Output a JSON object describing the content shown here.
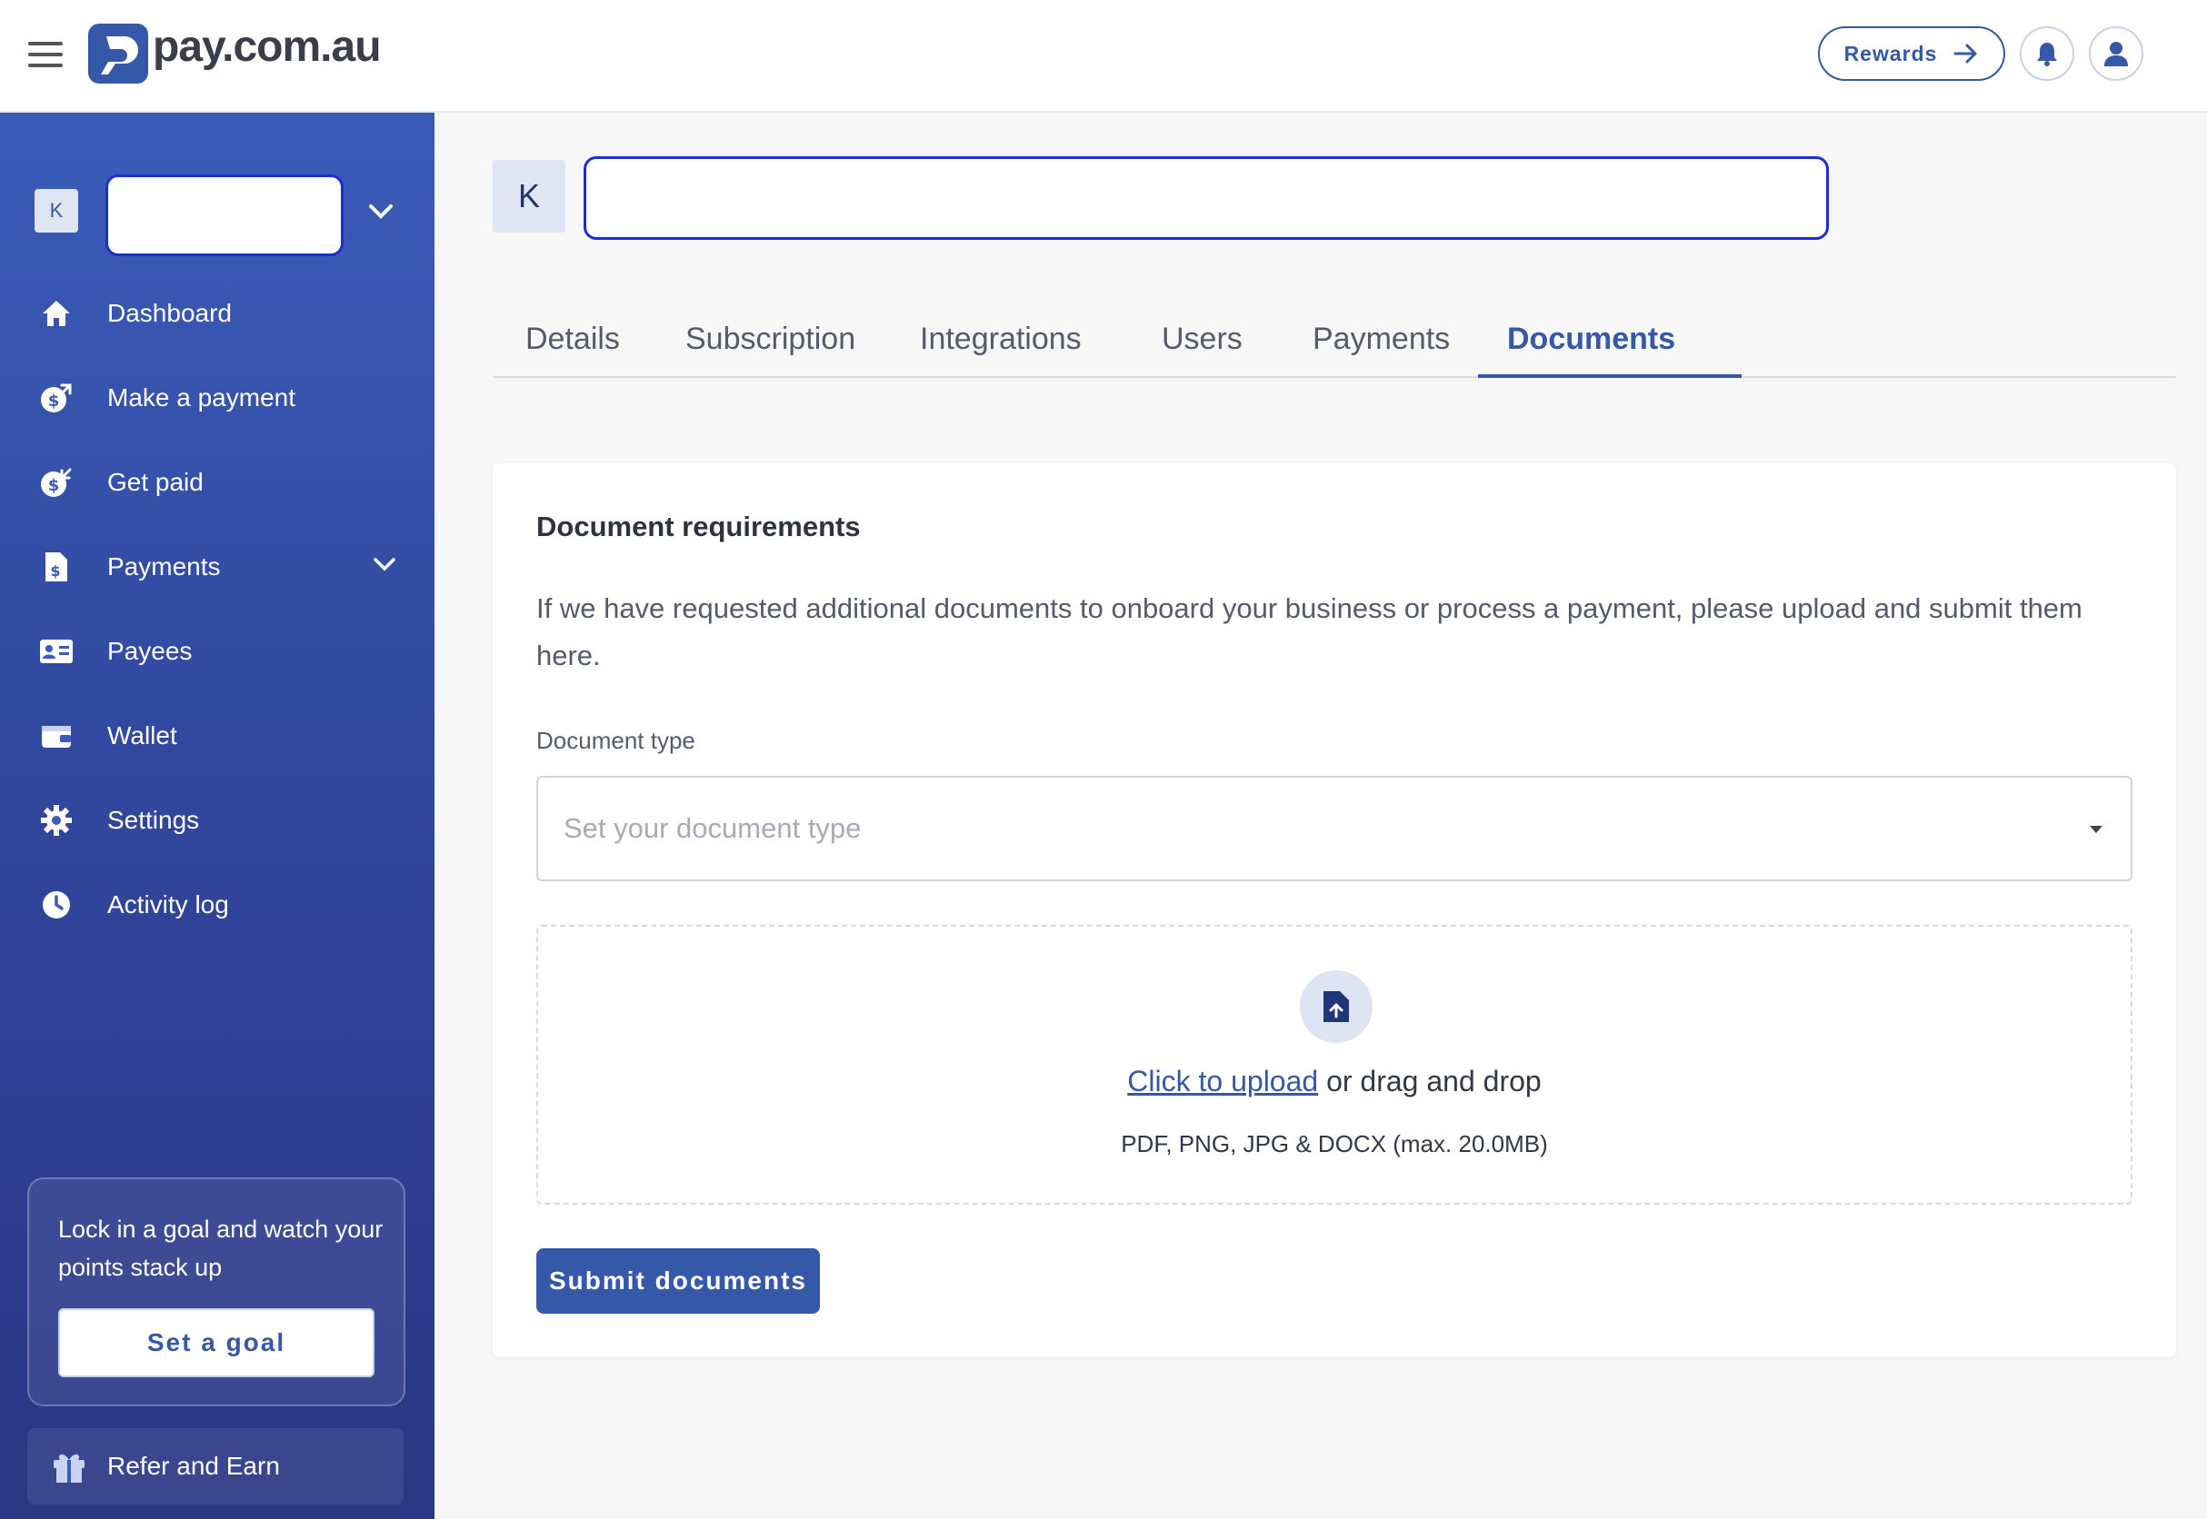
{
  "header": {
    "logo_text": "pay.com.au",
    "rewards_label": "Rewards"
  },
  "sidebar": {
    "account_initial": "K",
    "nav": [
      {
        "label": "Dashboard",
        "icon": "home-icon"
      },
      {
        "label": "Make a payment",
        "icon": "send-money-icon"
      },
      {
        "label": "Get paid",
        "icon": "receive-money-icon"
      },
      {
        "label": "Payments",
        "icon": "invoice-icon"
      },
      {
        "label": "Payees",
        "icon": "contact-card-icon"
      },
      {
        "label": "Wallet",
        "icon": "wallet-icon"
      },
      {
        "label": "Settings",
        "icon": "gear-icon"
      },
      {
        "label": "Activity log",
        "icon": "clock-icon"
      }
    ],
    "goal_text": "Lock in a goal and watch your points stack up",
    "goal_button": "Set a goal",
    "refer_label": "Refer and Earn"
  },
  "main": {
    "account_initial": "K",
    "tabs": [
      "Details",
      "Subscription",
      "Integrations",
      "Users",
      "Payments",
      "Documents"
    ],
    "active_tab": "Documents",
    "card": {
      "title": "Document requirements",
      "description": "If we have requested additional documents to onboard your business or process a payment, please upload and submit them here.",
      "doc_type_label": "Document type",
      "doc_type_placeholder": "Set your document type",
      "upload_link": "Click to upload",
      "upload_rest": " or drag and drop",
      "upload_hint": "PDF, PNG, JPG & DOCX (max. 20.0MB)",
      "submit_label": "Submit documents"
    }
  },
  "colors": {
    "brand": "#3558a8",
    "sidebar_top": "#3a5cb8",
    "sidebar_bottom": "#2b3684",
    "redaction_border": "#1a2dd6"
  }
}
